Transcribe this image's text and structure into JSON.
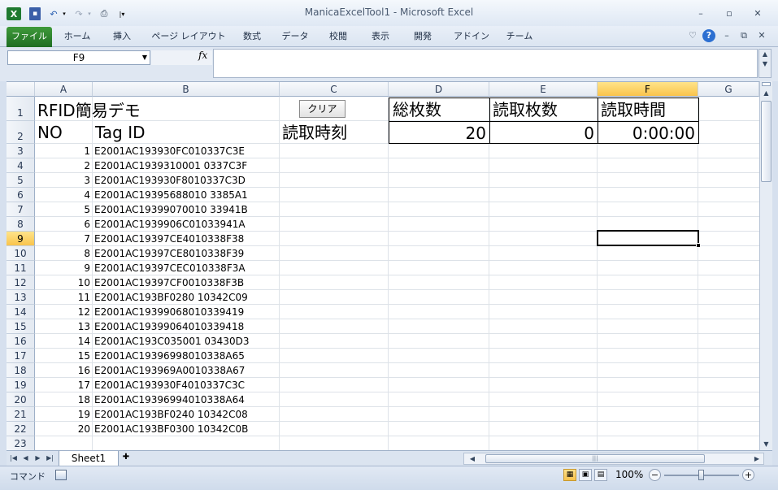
{
  "window": {
    "title": "ManicaExcelTool1 - Microsoft Excel"
  },
  "ribbon": {
    "tabs": [
      {
        "label": "ファイル"
      },
      {
        "label": "ホーム"
      },
      {
        "label": "挿入"
      },
      {
        "label": "ページ レイアウト"
      },
      {
        "label": "数式"
      },
      {
        "label": "データ"
      },
      {
        "label": "校閲"
      },
      {
        "label": "表示"
      },
      {
        "label": "開発"
      },
      {
        "label": "アドイン"
      },
      {
        "label": "チーム"
      }
    ]
  },
  "formula_bar": {
    "name_box": "F9",
    "fx_label": "fx",
    "value": ""
  },
  "sheet": {
    "columns": [
      "A",
      "B",
      "C",
      "D",
      "E",
      "F",
      "G"
    ],
    "selected_column": "F",
    "selected_row": "9",
    "row_numbers": [
      "1",
      "2",
      "3",
      "4",
      "5",
      "6",
      "7",
      "8",
      "9",
      "10",
      "11",
      "12",
      "13",
      "14",
      "15",
      "16",
      "17",
      "18",
      "19",
      "20",
      "21",
      "22",
      "23"
    ],
    "header": {
      "title": "RFID簡易デモ",
      "clear_button": "クリア",
      "total_label": "総枚数",
      "read_count_label": "読取枚数",
      "read_time_label": "読取時間",
      "no_label": "NO",
      "tag_label": "Tag ID",
      "read_at_label": "読取時刻",
      "total_value": "20",
      "read_count_value": "0",
      "read_time_value": "0:00:00"
    },
    "rows": [
      {
        "no": "1",
        "tag": "E2001AC193930FC010337C3E"
      },
      {
        "no": "2",
        "tag": "E2001AC1939310001 0337C3F"
      },
      {
        "no": "3",
        "tag": "E2001AC193930F8010337C3D"
      },
      {
        "no": "4",
        "tag": "E2001AC19395688010 3385A1"
      },
      {
        "no": "5",
        "tag": "E2001AC19399070010 33941B"
      },
      {
        "no": "6",
        "tag": "E2001AC1939906C01033941A"
      },
      {
        "no": "7",
        "tag": "E2001AC19397CE4010338F38"
      },
      {
        "no": "8",
        "tag": "E2001AC19397CE8010338F39"
      },
      {
        "no": "9",
        "tag": "E2001AC19397CEC010338F3A"
      },
      {
        "no": "10",
        "tag": "E2001AC19397CF0010338F3B"
      },
      {
        "no": "11",
        "tag": "E2001AC193BF0280 10342C09"
      },
      {
        "no": "12",
        "tag": "E2001AC19399068010339419"
      },
      {
        "no": "13",
        "tag": "E2001AC19399064010339418"
      },
      {
        "no": "14",
        "tag": "E2001AC193C035001 03430D3"
      },
      {
        "no": "15",
        "tag": "E2001AC19396998010338A65"
      },
      {
        "no": "16",
        "tag": "E2001AC193969A0010338A67"
      },
      {
        "no": "17",
        "tag": "E2001AC193930F4010337C3C"
      },
      {
        "no": "18",
        "tag": "E2001AC19396994010338A64"
      },
      {
        "no": "19",
        "tag": "E2001AC193BF0240 10342C08"
      },
      {
        "no": "20",
        "tag": "E2001AC193BF0300 10342C0B"
      }
    ]
  },
  "sheet_tabs": {
    "active": "Sheet1"
  },
  "status_bar": {
    "mode": "コマンド",
    "zoom": "100%"
  }
}
